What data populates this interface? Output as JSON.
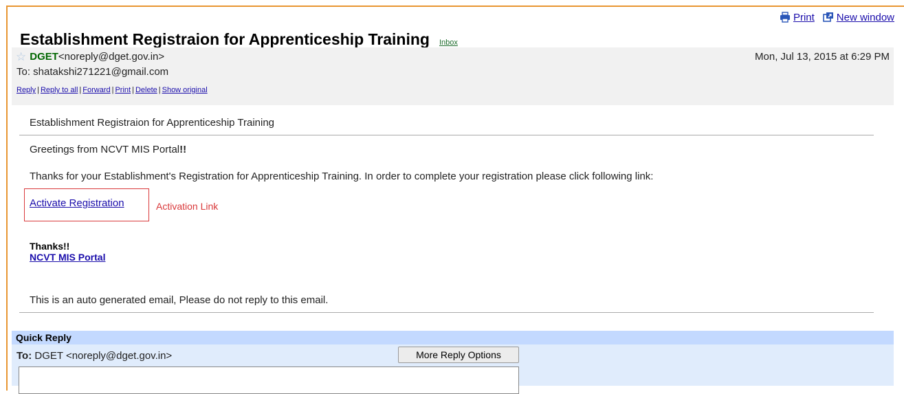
{
  "window": {
    "accent": "#e89531"
  },
  "toolbar": {
    "print_label": "Print",
    "new_window_label": "New window"
  },
  "subject": {
    "title": "Establishment Registraion for Apprenticeship Training",
    "label": "Inbox"
  },
  "header": {
    "sender_name": "DGET",
    "sender_email": "<noreply@dget.gov.in>",
    "date": "Mon, Jul 13, 2015 at 6:29 PM",
    "to": "To: shatakshi271221@gmail.com",
    "actions": [
      "Reply",
      "Reply to all",
      "Forward",
      "Print",
      "Delete",
      "Show original"
    ]
  },
  "body": {
    "subject": "Establishment Registraion for Apprenticeship Training",
    "greeting_main": "Greetings from NCVT MIS Portal",
    "greeting_bold": "!!",
    "thanks_text": "Thanks for your Establishment's Registration for Apprenticeship Training. In order to complete your registration please click following link:",
    "activate_link": "Activate Registration",
    "activation_note": "Activation Link",
    "thanks_bold": "Thanks!!",
    "portal_link": "NCVT MIS Portal",
    "auto_note": "This is an auto generated email, Please do not reply to this email."
  },
  "quick_reply": {
    "title": "Quick Reply",
    "to_label": "To:",
    "to_value": "DGET <noreply@dget.gov.in>",
    "more_options": "More Reply Options"
  }
}
